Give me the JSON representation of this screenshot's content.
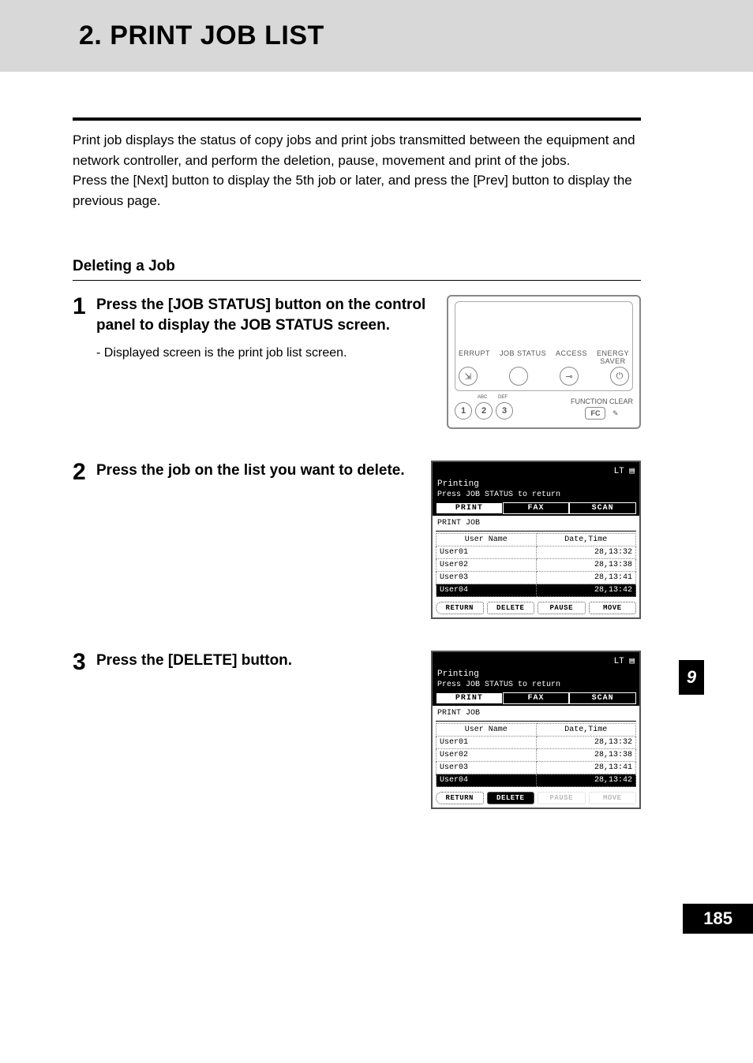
{
  "title": "2. PRINT JOB LIST",
  "intro": "Print job displays the status of copy jobs and print jobs transmitted between the equipment and network controller, and perform the deletion, pause, movement and print of the jobs.\nPress the [Next] button to display the 5th job or later, and press the [Prev] button to display the previous page.",
  "subsection": "Deleting a Job",
  "chapter_tab": "9",
  "page_number": "185",
  "steps": [
    {
      "num": "1",
      "title": "Press the [JOB STATUS] button on the control panel to display the JOB STATUS screen.",
      "note": "-   Displayed screen is the print job list screen."
    },
    {
      "num": "2",
      "title": "Press the job on the list you want to delete."
    },
    {
      "num": "3",
      "title": "Press the [DELETE] button."
    }
  ],
  "panel": {
    "labels": [
      "ERRUPT",
      "JOB STATUS",
      "ACCESS",
      "ENERGY\nSAVER"
    ],
    "num_buttons": [
      "1",
      "2",
      "3"
    ],
    "num_super": [
      "",
      "ABC",
      "DEF"
    ],
    "fc_label": "FUNCTION CLEAR",
    "fc_button": "FC"
  },
  "lcd_common": {
    "paper": "LT",
    "status": "Printing",
    "hint": "Press JOB STATUS to return",
    "tabs": [
      "PRINT",
      "FAX",
      "SCAN"
    ],
    "subtitle": "PRINT JOB",
    "col_user": "User Name",
    "col_time": "Date,Time",
    "rows": [
      {
        "user": "User01",
        "time": "28,13:32"
      },
      {
        "user": "User02",
        "time": "28,13:38"
      },
      {
        "user": "User03",
        "time": "28,13:41"
      },
      {
        "user": "User04",
        "time": "28,13:42"
      }
    ],
    "buttons": [
      "RETURN",
      "DELETE",
      "PAUSE",
      "MOVE"
    ]
  },
  "lcd_step2": {
    "selected_row": 3,
    "active_button": null,
    "disabled_buttons": []
  },
  "lcd_step3": {
    "selected_row": 3,
    "active_button": 1,
    "disabled_buttons": [
      2,
      3
    ]
  }
}
